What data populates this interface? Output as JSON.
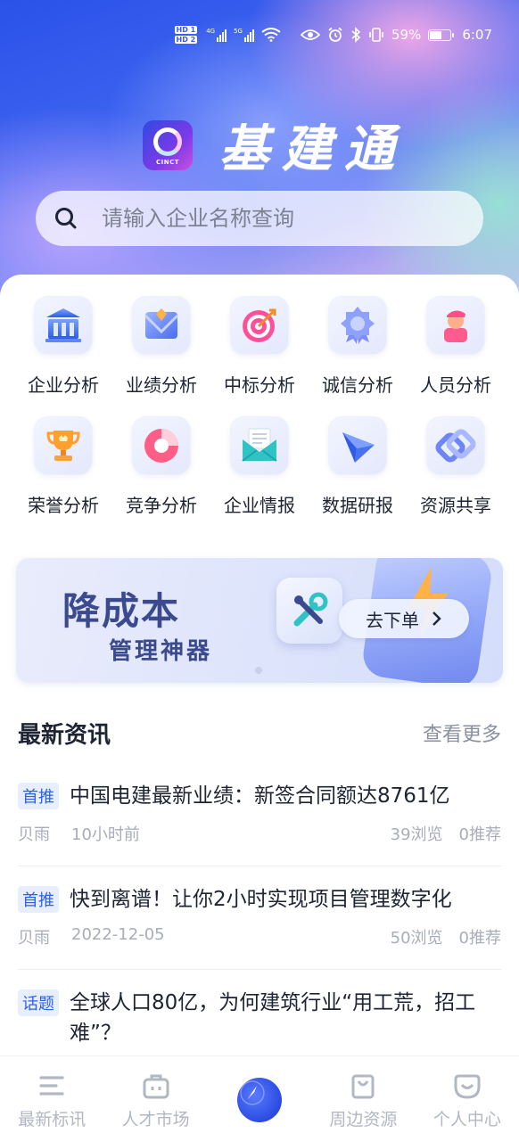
{
  "status_bar": {
    "hd1": "HD 1",
    "hd2": "HD 2",
    "net1": "4G",
    "net2": "5G",
    "battery": "59%",
    "battery_fraction": 0.59,
    "time": "6:07"
  },
  "brand": {
    "logo_text": "CINCT",
    "title": "基建通"
  },
  "search": {
    "placeholder": "请输入企业名称查询"
  },
  "features": [
    {
      "label": "企业分析",
      "icon": "bank-icon"
    },
    {
      "label": "业绩分析",
      "icon": "envelope-diamond-icon"
    },
    {
      "label": "中标分析",
      "icon": "target-icon"
    },
    {
      "label": "诚信分析",
      "icon": "badge-icon"
    },
    {
      "label": "人员分析",
      "icon": "person-icon"
    },
    {
      "label": "荣誉分析",
      "icon": "trophy-icon"
    },
    {
      "label": "竞争分析",
      "icon": "pie-icon"
    },
    {
      "label": "企业情报",
      "icon": "mail-icon"
    },
    {
      "label": "数据研报",
      "icon": "paper-plane-icon"
    },
    {
      "label": "资源共享",
      "icon": "share-knot-icon"
    }
  ],
  "banner": {
    "line1": "降成本",
    "line2": "管理神器",
    "cta": "去下单"
  },
  "news": {
    "title": "最新资讯",
    "more": "查看更多",
    "items": [
      {
        "tag": "首推",
        "title": "中国电建最新业绩：新签合同额达8761亿",
        "author": "贝雨",
        "time": "10小时前",
        "views": "39浏览",
        "recs": "0推荐"
      },
      {
        "tag": "首推",
        "title": "快到离谱！让你2小时实现项目管理数字化",
        "author": "贝雨",
        "time": "2022-12-05",
        "views": "50浏览",
        "recs": "0推荐"
      },
      {
        "tag": "话题",
        "title": "全球人口80亿，为何建筑行业“用工荒，招工难”？"
      }
    ]
  },
  "tabs": [
    {
      "label": "最新标讯",
      "icon": "list-icon"
    },
    {
      "label": "人才市场",
      "icon": "briefcase-icon"
    },
    {
      "label": "",
      "icon": "compass-icon"
    },
    {
      "label": "周边资源",
      "icon": "bag-icon"
    },
    {
      "label": "个人中心",
      "icon": "smile-icon"
    }
  ],
  "colors": {
    "primary": "#2d62e6",
    "text": "#1e2433",
    "muted": "#a8adba"
  }
}
